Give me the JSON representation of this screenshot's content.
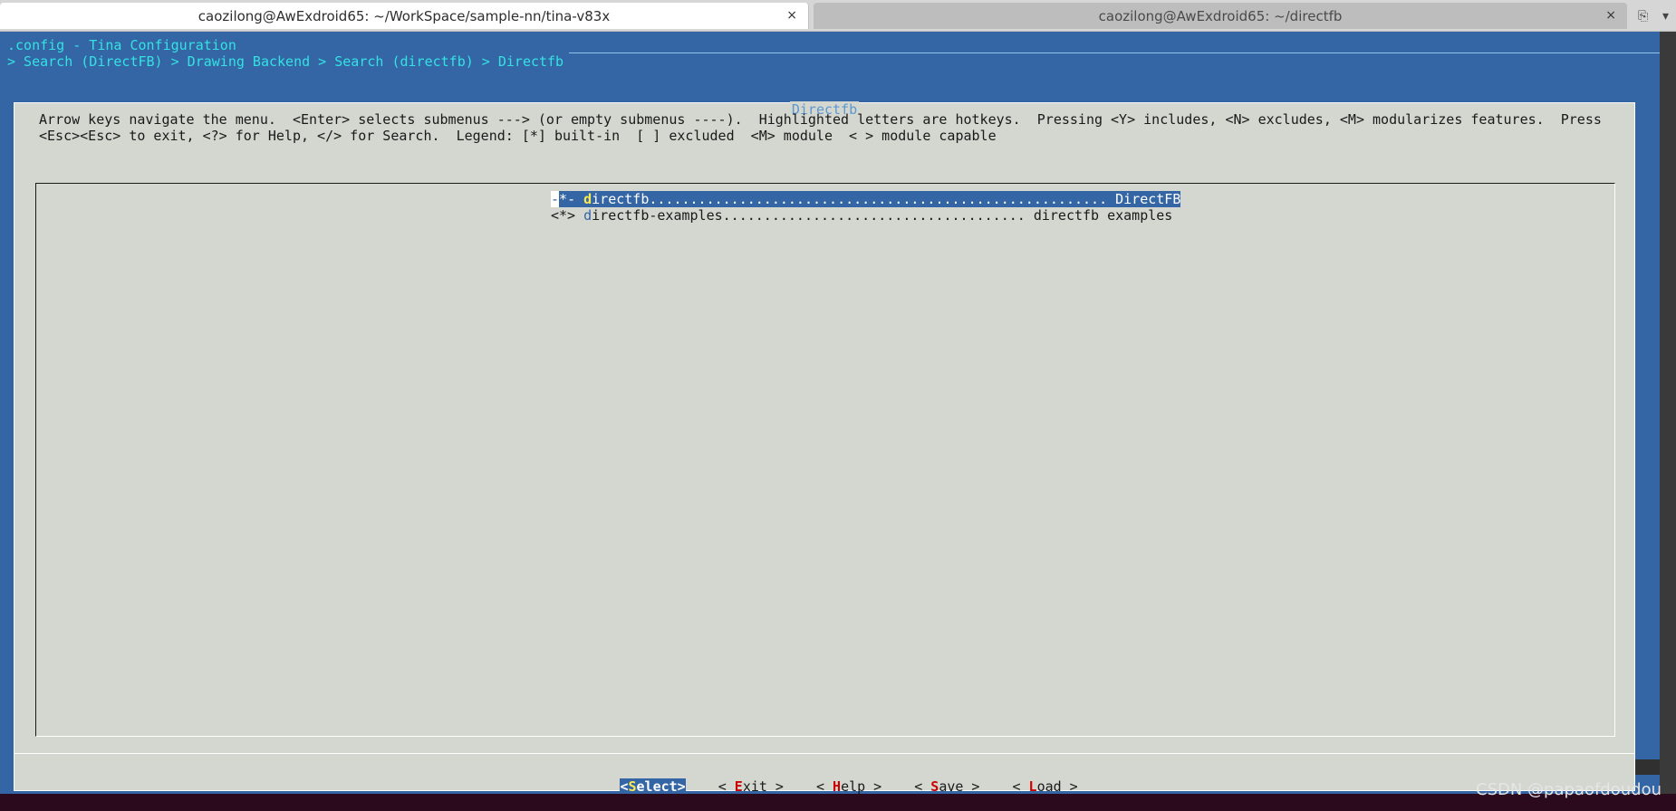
{
  "tabs": [
    {
      "title": "caozilong@AwExdroid65: ~/WorkSpace/sample-nn/tina-v83x",
      "close": "×"
    },
    {
      "title": "caozilong@AwExdroid65: ~/directfb",
      "close": "×"
    }
  ],
  "tab_tools": {
    "new_tab_icon": "⎘",
    "menu_icon": "▾"
  },
  "header": {
    "title_line": ".config - Tina Configuration",
    "breadcrumb": "> Search (DirectFB) > Drawing Backend > Search (directfb) > Directfb"
  },
  "dialog": {
    "title": "Directfb",
    "help_line1": "Arrow keys navigate the menu.  <Enter> selects submenus ---> (or empty submenus ----).  Highlighted letters are hotkeys.  Pressing <Y> includes, <N> excludes, <M> modularizes features.  Press",
    "help_line2": "<Esc><Esc> to exit, <?> for Help, </> for Search.  Legend: [*] built-in  [ ] excluded  <M> module  < > module capable",
    "items": [
      {
        "marker_a": "-",
        "marker_b": "*",
        "marker_c": "- ",
        "hotkey": "d",
        "rest": "irectfb........................................................ DirectFB"
      },
      {
        "marker": "<*> ",
        "hotkey": "d",
        "rest": "irectfb-examples..................................... directfb examples"
      }
    ],
    "buttons": [
      {
        "pre": "<",
        "key": "S",
        "post": "elect>"
      },
      {
        "pre": "< ",
        "key": "E",
        "post": "xit >"
      },
      {
        "pre": "< ",
        "key": "H",
        "post": "elp >"
      },
      {
        "pre": "< ",
        "key": "S",
        "post": "ave >"
      },
      {
        "pre": "< ",
        "key": "L",
        "post": "oad >"
      }
    ]
  },
  "watermark": "CSDN @papaofdoudou",
  "colors": {
    "terminal_bg": "#3465a4",
    "dialog_bg": "#d3d7cf",
    "highlight": "#3465a4",
    "hotkey": "#fce94f",
    "button_key": "#cc0000",
    "header_text": "#34e2e2"
  }
}
